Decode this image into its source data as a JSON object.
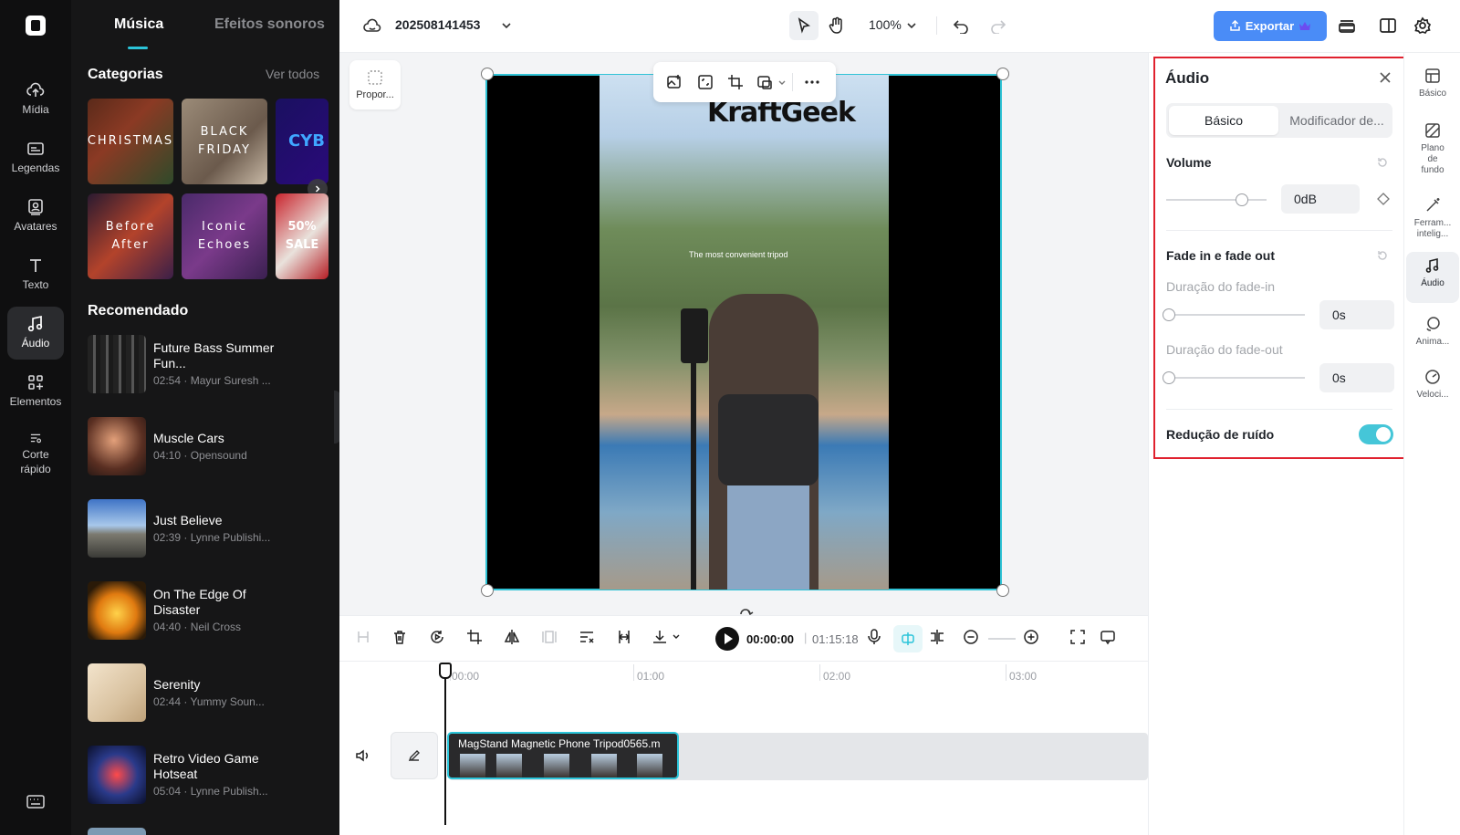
{
  "left_rail": {
    "items": [
      {
        "label": "Mídia",
        "icon": "cloud-upload-icon"
      },
      {
        "label": "Legendas",
        "icon": "captions-icon"
      },
      {
        "label": "Avatares",
        "icon": "avatar-icon"
      },
      {
        "label": "Texto",
        "icon": "text-icon"
      },
      {
        "label": "Áudio",
        "icon": "music-note-icon",
        "active": true
      },
      {
        "label": "Elementos",
        "icon": "elements-icon"
      },
      {
        "label": "Corte rápido",
        "icon": "quick-cut-icon"
      }
    ]
  },
  "music_panel": {
    "tabs": [
      "Música",
      "Efeitos sonoros"
    ],
    "active_tab": "Música",
    "categories_title": "Categorias",
    "see_all": "Ver todos",
    "categories": [
      "CHRISTMAS",
      "BLACK FRIDAY",
      "CYBER MONDAY",
      "Before After",
      "Iconic Echoes",
      "50% SALE"
    ],
    "recommended_title": "Recomendado",
    "tracks": [
      {
        "title": "Future Bass Summer Fun...",
        "meta": "02:54 · Mayur Suresh ..."
      },
      {
        "title": "Muscle Cars",
        "meta": "04:10 · Opensound"
      },
      {
        "title": "Just Believe",
        "meta": "02:39 · Lynne Publishi..."
      },
      {
        "title": "On The Edge Of Disaster",
        "meta": "04:40 · Neil Cross"
      },
      {
        "title": "Serenity",
        "meta": "02:44 · Yummy Soun..."
      },
      {
        "title": "Retro Video Game Hotseat",
        "meta": "05:04 · Lynne Publish..."
      }
    ]
  },
  "topbar": {
    "project_name": "202508141453",
    "zoom": "100%",
    "export_label": "Exportar"
  },
  "canvas": {
    "ratio_label": "Propor...",
    "video_brand": "KraftGeek",
    "video_caption": "The most convenient tripod"
  },
  "timeline": {
    "current_time": "00:00:00",
    "separator": "|",
    "total_time": "01:15:18",
    "ruler": [
      "00:00",
      "01:00",
      "02:00",
      "03:00"
    ],
    "clip_name": "MagStand Magnetic Phone Tripod0565.m"
  },
  "properties": {
    "title": "Áudio",
    "segments": [
      "Básico",
      "Modificador de..."
    ],
    "volume_label": "Volume",
    "volume_value": "0dB",
    "volume_level": 0.75,
    "fade_label": "Fade in e fade out",
    "fade_in_label": "Duração do fade-in",
    "fade_in_value": "0s",
    "fade_out_label": "Duração do fade-out",
    "fade_out_value": "0s",
    "noise_label": "Redução de ruído",
    "noise_enabled": true
  },
  "right_rail": {
    "items": [
      {
        "label": "Básico",
        "icon": "basic-icon"
      },
      {
        "label": "Plano de fundo",
        "icon": "background-icon"
      },
      {
        "label": "Ferram... intelig...",
        "icon": "smart-tools-icon"
      },
      {
        "label": "Áudio",
        "icon": "audio-icon",
        "active": true
      },
      {
        "label": "Anima...",
        "icon": "animation-icon"
      },
      {
        "label": "Veloci...",
        "icon": "speed-icon"
      }
    ]
  },
  "colors": {
    "accent": "#2bc4d9",
    "export": "#4a8cf7",
    "highlight_outline": "#e0212e"
  }
}
